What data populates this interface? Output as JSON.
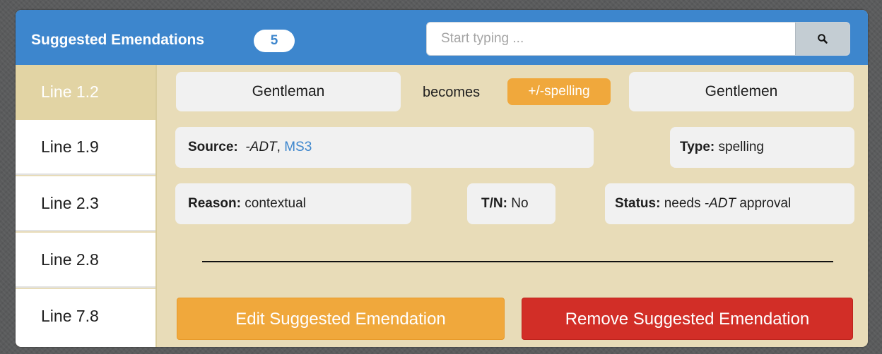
{
  "header": {
    "title": "Suggested Emendations",
    "count": "5"
  },
  "search": {
    "placeholder": "Start typing ...",
    "button_icon": "search-icon"
  },
  "sidebar": {
    "items": [
      {
        "label": "Line 1.2",
        "active": true
      },
      {
        "label": "Line 1.9",
        "active": false
      },
      {
        "label": "Line 2.3",
        "active": false
      },
      {
        "label": "Line 2.8",
        "active": false
      },
      {
        "label": "Line 7.8",
        "active": false
      }
    ]
  },
  "emendation": {
    "original": "Gentleman",
    "becomes": "becomes",
    "tag": "+/-spelling",
    "replacement": "Gentlemen",
    "source": {
      "label": "Source:",
      "value": "-ADT",
      "separator": ",",
      "link": "MS3"
    },
    "type": {
      "label": "Type:",
      "value": "spelling"
    },
    "reason": {
      "label": "Reason:",
      "value": "contextual"
    },
    "tn": {
      "label": "T/N:",
      "value": "No"
    },
    "status": {
      "label": "Status:",
      "prefix": "needs",
      "emphasis": "-ADT",
      "suffix": "approval"
    }
  },
  "actions": {
    "edit": "Edit Suggested Emendation",
    "remove": "Remove Suggested Emendation"
  },
  "colors": {
    "header": "#3d86cd",
    "panel": "#e8dcb8",
    "tag": "#f0a83c",
    "edit_button": "#f0a83c",
    "remove_button": "#d22e27",
    "link": "#3d86cd"
  }
}
